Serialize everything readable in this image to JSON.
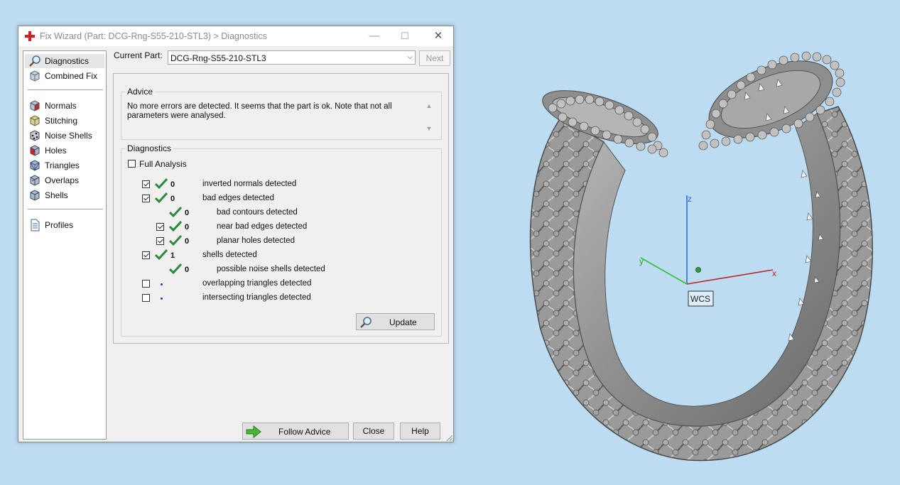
{
  "window": {
    "title": "Fix Wizard (Part: DCG-Rng-S55-210-STL3) > Diagnostics",
    "controls": [
      "—",
      "☐",
      "✕"
    ]
  },
  "nav": {
    "items": [
      {
        "label": "Diagnostics",
        "icon": "magnifier-icon",
        "selected": true
      },
      {
        "label": "Combined Fix",
        "icon": "combined-fix-icon"
      },
      {
        "label": "Normals",
        "icon": "normals-cube-icon"
      },
      {
        "label": "Stitching",
        "icon": "stitching-cube-icon"
      },
      {
        "label": "Noise Shells",
        "icon": "noise-shells-cube-icon"
      },
      {
        "label": "Holes",
        "icon": "holes-cube-icon"
      },
      {
        "label": "Triangles",
        "icon": "triangles-cube-icon"
      },
      {
        "label": "Overlaps",
        "icon": "overlaps-cube-icon"
      },
      {
        "label": "Shells",
        "icon": "shells-cube-icon"
      },
      {
        "label": "Profiles",
        "icon": "profiles-document-icon"
      }
    ]
  },
  "current_part": {
    "label": "Current Part:",
    "value": "DCG-Rng-S55-210-STL3"
  },
  "next_label": "Next",
  "advice": {
    "title": "Advice",
    "text_line1": "No more errors are detected. It seems that the part is ok. Note that not all",
    "text_line2": "parameters were analysed."
  },
  "diagnostics": {
    "title": "Diagnostics",
    "full_analysis_label": "Full Analysis",
    "full_analysis_checked": false,
    "rows": [
      {
        "checkbox": true,
        "checked": true,
        "status": "ok",
        "count": "0",
        "label": "inverted normals detected"
      },
      {
        "checkbox": true,
        "checked": true,
        "status": "ok",
        "count": "0",
        "label": "bad edges detected"
      },
      {
        "checkbox": false,
        "checked": false,
        "status": "ok",
        "count": "0",
        "label": "bad contours detected"
      },
      {
        "checkbox": true,
        "checked": true,
        "status": "ok",
        "count": "0",
        "label": "near bad edges detected"
      },
      {
        "checkbox": true,
        "checked": true,
        "status": "ok",
        "count": "0",
        "label": "planar holes detected"
      },
      {
        "checkbox": true,
        "checked": true,
        "status": "ok",
        "count": "1",
        "label": "shells detected"
      },
      {
        "checkbox": false,
        "checked": false,
        "status": "ok",
        "count": "0",
        "label": "possible noise shells detected"
      },
      {
        "checkbox": true,
        "checked": false,
        "status": "not-analysed",
        "count": "",
        "label": "overlapping triangles detected"
      },
      {
        "checkbox": true,
        "checked": false,
        "status": "not-analysed",
        "count": "",
        "label": "intersecting triangles detected"
      }
    ],
    "update_label": "Update"
  },
  "footer": {
    "follow_advice_label": "Follow Advice",
    "close_label": "Close",
    "help_label": "Help"
  },
  "viewport": {
    "axis_x": "x",
    "axis_y": "y",
    "axis_z": "z",
    "wcs_label": "WCS",
    "colors": {
      "x_axis": "#c0202a",
      "y_axis": "#30c030",
      "z_axis": "#2a6ad8",
      "background": "#bcdcf2",
      "model": "#9a9a9a"
    }
  }
}
